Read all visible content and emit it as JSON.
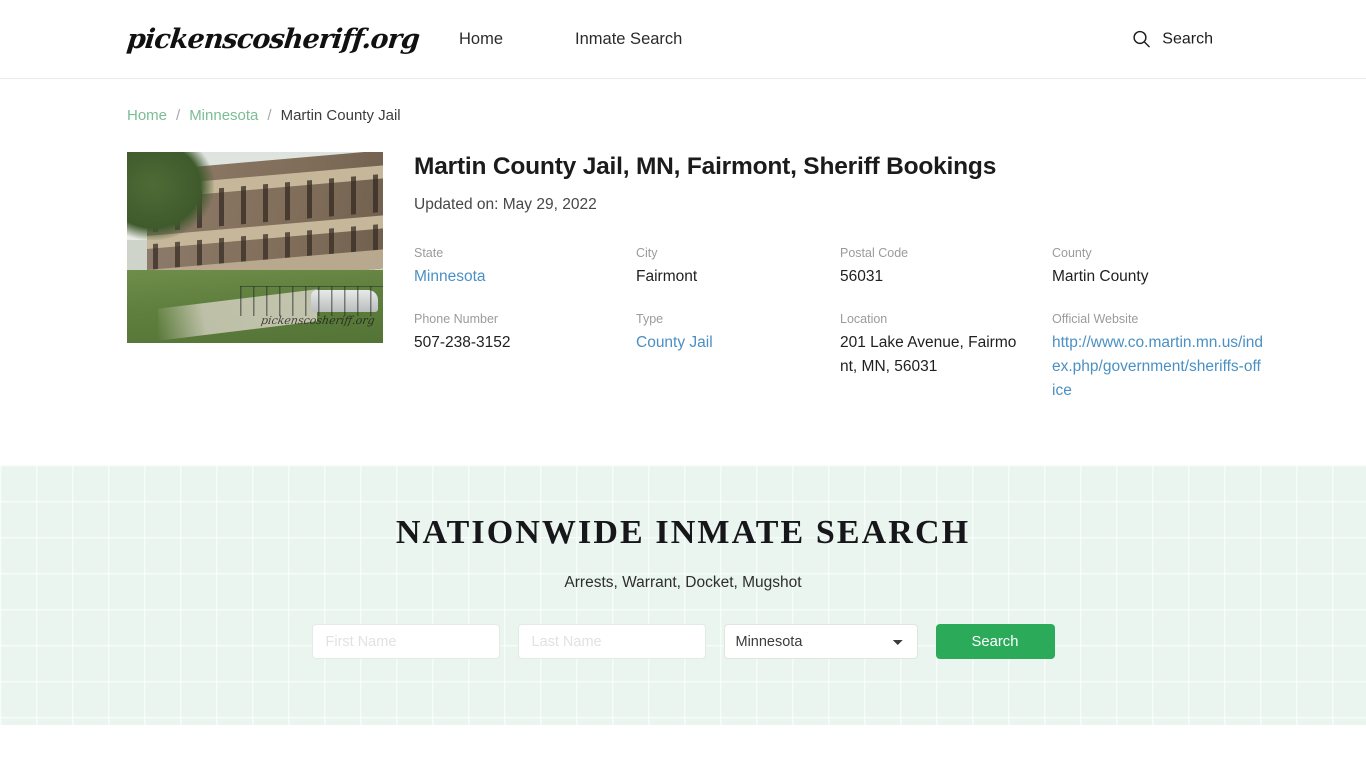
{
  "header": {
    "brand": "pickenscosheriff.org",
    "nav": [
      {
        "label": "Home"
      },
      {
        "label": "Inmate Search"
      }
    ],
    "search": {
      "icon": "search-icon",
      "label": "Search"
    }
  },
  "breadcrumb": {
    "items": [
      {
        "label": "Home",
        "link": true
      },
      {
        "label": "Minnesota",
        "link": true
      },
      {
        "label": "Martin County Jail",
        "link": false
      }
    ],
    "separator": "/"
  },
  "main": {
    "thumbnail_watermark": "pickenscosheriff.org",
    "title": "Martin County Jail, MN, Fairmont, Sheriff Bookings",
    "updated": "Updated on: May 29, 2022",
    "fields": [
      {
        "label": "State",
        "value": "Minnesota",
        "link": true
      },
      {
        "label": "City",
        "value": "Fairmont",
        "link": false
      },
      {
        "label": "Postal Code",
        "value": "56031",
        "link": false
      },
      {
        "label": "County",
        "value": "Martin County",
        "link": false
      },
      {
        "label": "Phone Number",
        "value": "507-238-3152",
        "link": false
      },
      {
        "label": "Type",
        "value": "County Jail",
        "link": true
      },
      {
        "label": "Location",
        "value": "201 Lake Avenue, Fairmont, MN, 56031",
        "link": false
      },
      {
        "label": "Official Website",
        "value": "http://www.co.martin.mn.us/index.php/government/sheriffs-office",
        "link": true
      }
    ]
  },
  "search_band": {
    "title": "NATIONWIDE INMATE SEARCH",
    "subtitle": "Arrests, Warrant, Docket, Mugshot",
    "first_name_placeholder": "First Name",
    "first_name_value": "",
    "last_name_placeholder": "Last Name",
    "last_name_value": "",
    "state_selected": "Minnesota",
    "state_options": [
      "Minnesota"
    ],
    "button_label": "Search"
  },
  "colors": {
    "band_background": "#e9f5ee",
    "button_green": "#2bab5a",
    "breadcrumb_link": "#7bbd94",
    "info_link": "#4a90c4"
  }
}
